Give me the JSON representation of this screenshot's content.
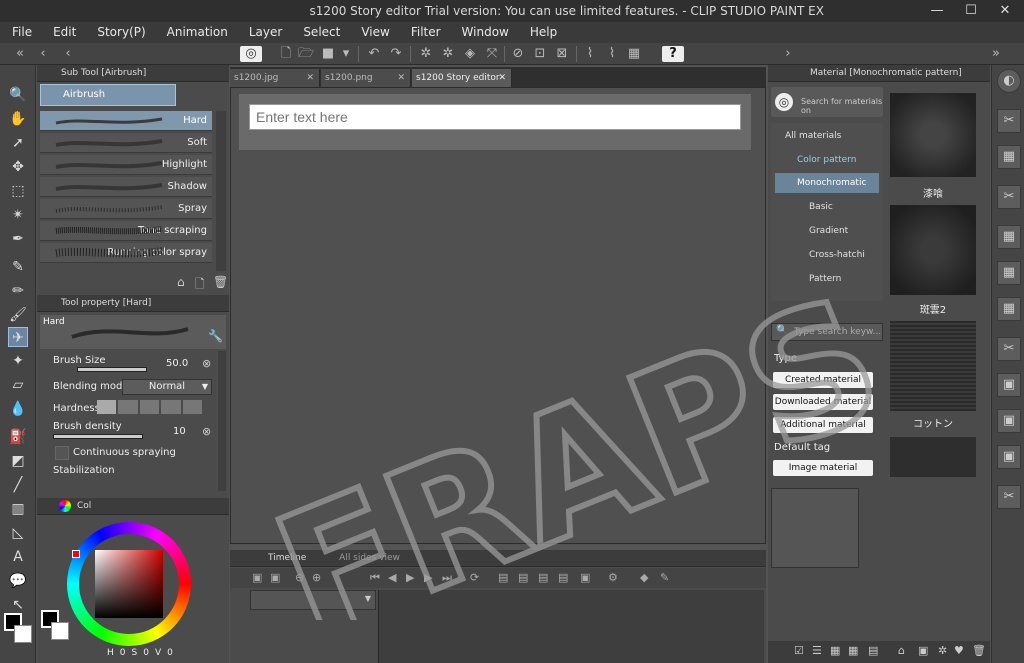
{
  "window": {
    "title": "s1200 Story editor Trial version: You can use limited features. - CLIP STUDIO PAINT EX",
    "minimize": "—",
    "maximize": "☐",
    "close": "✕"
  },
  "menu": [
    "File",
    "Edit",
    "Story(P)",
    "Animation",
    "Layer",
    "Select",
    "View",
    "Filter",
    "Window",
    "Help"
  ],
  "subtool": {
    "title": "Sub Tool [Airbrush]",
    "group": "Airbrush",
    "brushes": [
      "Hard",
      "Soft",
      "Highlight",
      "Shadow",
      "Spray",
      "Tone scraping",
      "Running color spray"
    ]
  },
  "toolprop": {
    "title": "Tool property [Hard]",
    "brush_name": "Hard",
    "brush_size_label": "Brush Size",
    "brush_size_value": "50.0",
    "blending_label": "Blending mode",
    "blending_value": "Normal",
    "hardness_label": "Hardness",
    "density_label": "Brush density",
    "density_value": "10",
    "continuous_label": "Continuous spraying",
    "stabilization_label": "Stabilization"
  },
  "color": {
    "tab_label": "Col",
    "hsv": [
      "H",
      "0",
      "S",
      "0",
      "V",
      "0"
    ],
    "main_color": "#000000",
    "sub_color": "#ffffff",
    "accent_red": "#8b2020"
  },
  "tabs": [
    "s1200.jpg",
    "s1200.png",
    "s1200 Story editor"
  ],
  "story": {
    "placeholder": "Enter text here"
  },
  "timeline": {
    "tab_label": "Timeline",
    "tab2_label": "All sides view"
  },
  "material": {
    "title": "Material [Monochromatic pattern]",
    "search_placeholder": "Search for materials on",
    "tree": [
      "All materials",
      "Color pattern",
      "Monochromatic",
      "Basic",
      "Gradient",
      "Cross-hatchi",
      "Pattern"
    ],
    "keyword_placeholder": "Type search keyw...",
    "type_label": "Type",
    "type_buttons": [
      "Created material",
      "Downloaded material",
      "Additional material"
    ],
    "default_tag_label": "Default tag",
    "default_tag_button": "Image material",
    "thumb_labels": [
      "漆喰",
      "斑雲2",
      "コットン"
    ]
  },
  "watermark": "FRAPS.PRO"
}
